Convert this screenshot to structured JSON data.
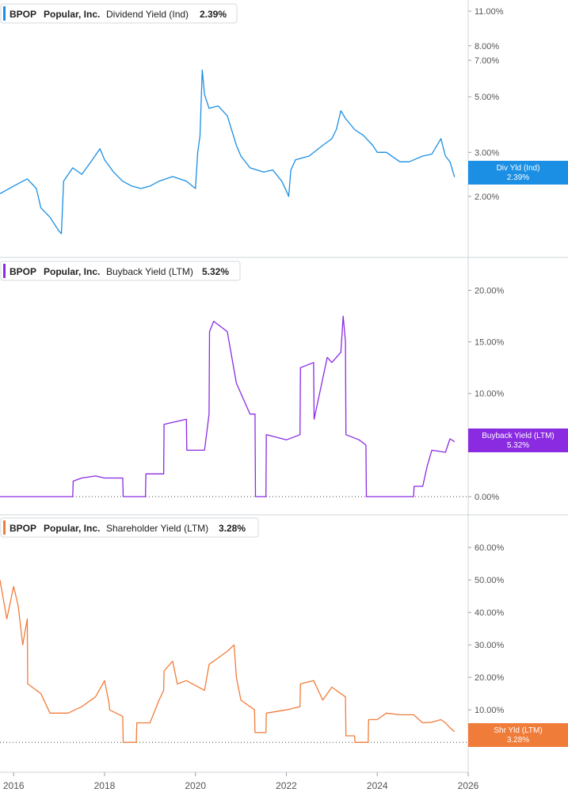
{
  "panels": [
    {
      "ticker": "BPOP",
      "company": "Popular, Inc.",
      "metric": "Dividend Yield (Ind)",
      "value": "2.39%",
      "tag_line1": "Div Yld (Ind)",
      "tag_line2": "2.39%",
      "color": "#1a8fe3"
    },
    {
      "ticker": "BPOP",
      "company": "Popular, Inc.",
      "metric": "Buyback Yield (LTM)",
      "value": "5.32%",
      "tag_line1": "Buyback Yield (LTM)",
      "tag_line2": "5.32%",
      "color": "#8a2be2"
    },
    {
      "ticker": "BPOP",
      "company": "Popular, Inc.",
      "metric": "Shareholder Yield (LTM)",
      "value": "3.28%",
      "tag_line1": "Shr Yld (LTM)",
      "tag_line2": "3.28%",
      "color": "#f07c3a"
    }
  ],
  "chart_data": [
    {
      "type": "line",
      "ylabel": "",
      "scale": "log",
      "yticks": [
        "11.00%",
        "8.00%",
        "7.00%",
        "5.00%",
        "3.00%",
        "2.00%"
      ],
      "ytick_values": [
        11,
        8,
        7,
        5,
        3,
        2
      ],
      "ylim": [
        1.2,
        11.5
      ],
      "series": [
        {
          "x": [
            2015.7,
            2016.0,
            2016.3,
            2016.5,
            2016.6,
            2016.8,
            2017.0,
            2017.05,
            2017.1,
            2017.3,
            2017.5,
            2017.7,
            2017.9,
            2018.0,
            2018.2,
            2018.4,
            2018.6,
            2018.8,
            2019.0,
            2019.2,
            2019.5,
            2019.8,
            2020.0,
            2020.05,
            2020.1,
            2020.15,
            2020.2,
            2020.3,
            2020.5,
            2020.7,
            2020.9,
            2021.0,
            2021.2,
            2021.5,
            2021.7,
            2021.9,
            2022.0,
            2022.05,
            2022.1,
            2022.2,
            2022.5,
            2022.8,
            2023.0,
            2023.1,
            2023.2,
            2023.3,
            2023.5,
            2023.7,
            2023.9,
            2024.0,
            2024.2,
            2024.5,
            2024.7,
            2025.0,
            2025.2,
            2025.4,
            2025.5,
            2025.6,
            2025.7
          ],
          "values": [
            2.05,
            2.2,
            2.35,
            2.15,
            1.8,
            1.65,
            1.45,
            1.42,
            2.3,
            2.6,
            2.45,
            2.75,
            3.1,
            2.8,
            2.5,
            2.3,
            2.2,
            2.15,
            2.2,
            2.3,
            2.4,
            2.3,
            2.15,
            3.0,
            3.5,
            6.4,
            5.1,
            4.5,
            4.6,
            4.2,
            3.2,
            2.9,
            2.6,
            2.5,
            2.55,
            2.3,
            2.1,
            2.0,
            2.55,
            2.8,
            2.9,
            3.2,
            3.4,
            3.7,
            4.4,
            4.1,
            3.7,
            3.5,
            3.2,
            3.0,
            3.0,
            2.75,
            2.75,
            2.9,
            2.95,
            3.4,
            2.9,
            2.75,
            2.39
          ]
        }
      ]
    },
    {
      "type": "line",
      "ylabel": "",
      "yticks": [
        "20.00%",
        "15.00%",
        "10.00%",
        "0.00%"
      ],
      "ytick_values": [
        20,
        15,
        10,
        0
      ],
      "ylim": [
        -1,
        20.5
      ],
      "series": [
        {
          "x": [
            2015.7,
            2017.3,
            2017.31,
            2017.5,
            2017.8,
            2018.0,
            2018.4,
            2018.41,
            2018.9,
            2018.91,
            2019.3,
            2019.31,
            2019.8,
            2019.81,
            2020.2,
            2020.3,
            2020.31,
            2020.4,
            2020.7,
            2020.9,
            2021.2,
            2021.31,
            2021.32,
            2021.55,
            2021.56,
            2022.0,
            2022.3,
            2022.31,
            2022.6,
            2022.61,
            2022.9,
            2023.0,
            2023.2,
            2023.25,
            2023.3,
            2023.31,
            2023.6,
            2023.75,
            2023.76,
            2024.8,
            2024.81,
            2025.0,
            2025.1,
            2025.2,
            2025.5,
            2025.6,
            2025.7
          ],
          "values": [
            0,
            0,
            1.5,
            1.8,
            2.0,
            1.8,
            1.8,
            0,
            0,
            2.2,
            2.2,
            7.0,
            7.5,
            4.5,
            4.5,
            8.0,
            16.0,
            17.0,
            16.0,
            11.0,
            8.0,
            8.0,
            0,
            0,
            6.0,
            5.5,
            6.0,
            12.5,
            13.0,
            7.5,
            13.5,
            13.0,
            14.0,
            17.5,
            15.0,
            6.0,
            5.5,
            5.0,
            0,
            0,
            1.0,
            1.0,
            3.0,
            4.5,
            4.3,
            5.6,
            5.32
          ]
        }
      ]
    },
    {
      "type": "line",
      "ylabel": "",
      "yticks": [
        "60.00%",
        "50.00%",
        "40.00%",
        "30.00%",
        "20.00%",
        "10.00%",
        "0.00%"
      ],
      "ytick_values": [
        60,
        50,
        40,
        30,
        20,
        10,
        0
      ],
      "ylim": [
        -8,
        62
      ],
      "series": [
        {
          "x": [
            2015.7,
            2015.85,
            2016.0,
            2016.1,
            2016.2,
            2016.3,
            2016.31,
            2016.6,
            2016.8,
            2017.2,
            2017.5,
            2017.8,
            2018.0,
            2018.1,
            2018.11,
            2018.4,
            2018.41,
            2018.7,
            2018.71,
            2019.0,
            2019.2,
            2019.3,
            2019.31,
            2019.5,
            2019.6,
            2019.8,
            2020.2,
            2020.3,
            2020.5,
            2020.7,
            2020.85,
            2020.9,
            2021.0,
            2021.3,
            2021.31,
            2021.55,
            2021.56,
            2022.0,
            2022.3,
            2022.31,
            2022.6,
            2022.8,
            2023.0,
            2023.1,
            2023.2,
            2023.3,
            2023.31,
            2023.5,
            2023.51,
            2023.8,
            2023.81,
            2024.0,
            2024.2,
            2024.5,
            2024.8,
            2025.0,
            2025.2,
            2025.4,
            2025.5,
            2025.6,
            2025.7
          ],
          "values": [
            50,
            38,
            48,
            42,
            30,
            38,
            18,
            15,
            9,
            9,
            11,
            14,
            19,
            12,
            10,
            8,
            0,
            0,
            6,
            6,
            13,
            16,
            22,
            25,
            18,
            19,
            16,
            24,
            26,
            28,
            30,
            20,
            13,
            10,
            3,
            3,
            9,
            10,
            11,
            18,
            19,
            13,
            17,
            16,
            15,
            14,
            2,
            2,
            0,
            0,
            7,
            7,
            9,
            8.5,
            8.5,
            6,
            6.2,
            7,
            6,
            4.5,
            3.28
          ]
        }
      ]
    }
  ],
  "x_axis": {
    "ticks": [
      "2016",
      "2018",
      "2020",
      "2022",
      "2024",
      "2026"
    ],
    "tick_values": [
      2016,
      2018,
      2020,
      2022,
      2024,
      2026
    ],
    "xlim": [
      2015.7,
      2026.0
    ]
  }
}
